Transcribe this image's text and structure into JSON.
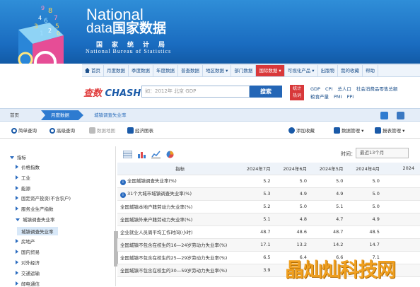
{
  "banner": {
    "logo_en_line1": "National",
    "logo_en_line2_prefix": "data",
    "logo_en_line2_cn": "国家数据",
    "logo_sub": "国家统计局",
    "logo_bureau": "National Bureau of Statistics",
    "cube_digits": [
      "8",
      "7",
      "6",
      "5",
      "4",
      "3",
      "2",
      "1",
      "0",
      "9"
    ]
  },
  "nav": {
    "items": [
      {
        "label": "首页",
        "active": false
      },
      {
        "label": "月度数据",
        "active": false
      },
      {
        "label": "季度数据",
        "active": false
      },
      {
        "label": "年度数据",
        "active": false
      },
      {
        "label": "普查数据",
        "active": false
      },
      {
        "label": "地区数据 ▾",
        "active": false
      },
      {
        "label": "部门数据",
        "active": false
      },
      {
        "label": "国际数据 ▾",
        "active": true
      },
      {
        "label": "可视化产品 ▾",
        "active": false
      },
      {
        "label": "出版物",
        "active": false
      },
      {
        "label": "我的收藏",
        "active": false
      },
      {
        "label": "帮助",
        "active": false
      }
    ]
  },
  "search": {
    "brand_cn": "查数",
    "brand_en": "CHASHU",
    "placeholder": "如：2012年 北京 GDP",
    "button_label": "搜索",
    "hot_tag_line1": "统计",
    "hot_tag_line2": "热词",
    "hot_words_row1": [
      "GDP",
      "CPI",
      "总人口",
      "社会消费品零售总额"
    ],
    "hot_words_row2": [
      "粮食产量",
      "PMI",
      "PPI"
    ]
  },
  "breadcrumb": {
    "home": "首页",
    "section": "月度数据",
    "current": "城镇调查失业率"
  },
  "toolbar": {
    "simple_query": "简单查询",
    "advanced_query": "高级查询",
    "data_map": "数据地图",
    "stats_chart": "经济图表",
    "add_favorite": "添加收藏",
    "data_manage": "数据管理 ▾",
    "report_manage": "报表管理 ▾"
  },
  "sidebar": {
    "root": "指标",
    "items": [
      {
        "label": "价格指数",
        "selected": false
      },
      {
        "label": "工业",
        "selected": false
      },
      {
        "label": "能源",
        "selected": false
      },
      {
        "label": "固定资产投资(不含农户)",
        "selected": false
      },
      {
        "label": "服务业生产指数",
        "selected": false
      },
      {
        "label": "城镇调查失业率",
        "selected": false
      },
      {
        "label": "城镇调查失业率",
        "selected": true
      },
      {
        "label": "房地产",
        "selected": false
      },
      {
        "label": "国内贸易",
        "selected": false
      },
      {
        "label": "对外经济",
        "selected": false
      },
      {
        "label": "交通运输",
        "selected": false
      },
      {
        "label": "邮电通信",
        "selected": false
      }
    ]
  },
  "main": {
    "time_label": "时间：",
    "time_select": "最近13个月",
    "table": {
      "header": [
        "指标",
        "2024年7月",
        "2024年6月",
        "2024年5月",
        "2024年4月",
        "2024"
      ],
      "rows": [
        {
          "name": "全国城镇调查失业率(%)",
          "info": true,
          "values": [
            "5.2",
            "5.0",
            "5.0",
            "5.0",
            ""
          ]
        },
        {
          "name": "31个大城市城镇调查失业率(%)",
          "info": true,
          "values": [
            "5.3",
            "4.9",
            "4.9",
            "5.0",
            ""
          ]
        },
        {
          "name": "全国城镇本地户籍劳动力失业率(%)",
          "info": false,
          "values": [
            "5.2",
            "5.0",
            "5.1",
            "5.0",
            ""
          ]
        },
        {
          "name": "全国城镇外来户籍劳动力失业率(%)",
          "info": false,
          "values": [
            "5.1",
            "4.8",
            "4.7",
            "4.9",
            ""
          ]
        },
        {
          "name": "企业就业人员周平均工作时间(小时)",
          "info": false,
          "values": [
            "48.7",
            "48.6",
            "48.7",
            "48.5",
            ""
          ]
        },
        {
          "name": "全国城镇不包含在校生的16—24岁劳动力失业率(%)",
          "info": false,
          "values": [
            "17.1",
            "13.2",
            "14.2",
            "14.7",
            ""
          ]
        },
        {
          "name": "全国城镇不包含在校生的25—29岁劳动力失业率(%)",
          "info": false,
          "values": [
            "6.5",
            "6.4",
            "6.6",
            "7.1",
            ""
          ]
        },
        {
          "name": "全国城镇不包含在校生的30—59岁劳动力失业率(%)",
          "info": false,
          "values": [
            "3.9",
            "",
            "",
            "",
            ""
          ]
        }
      ]
    }
  },
  "watermark": "晶灿灿科技网",
  "colors": {
    "brand_blue": "#1a6cc0",
    "accent_red": "#d9383a",
    "watermark": "#f0a020"
  }
}
